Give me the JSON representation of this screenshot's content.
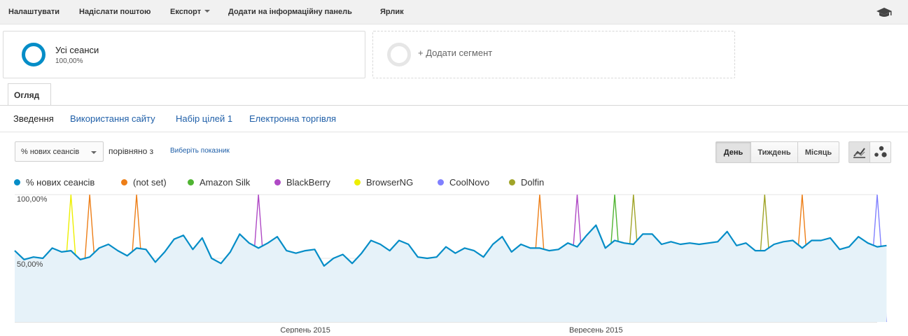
{
  "toolbar": {
    "items": [
      "Налаштувати",
      "Надіслати поштою",
      "Експорт",
      "Додати на інформаційну панель",
      "Ярлик"
    ]
  },
  "segments": {
    "all_sessions": {
      "name": "Усі сеанси",
      "percent": "100,00%"
    },
    "add_segment": "+ Додати сегмент"
  },
  "tab": {
    "label": "Огляд"
  },
  "subnav": [
    "Зведення",
    "Використання сайту",
    "Набір цілей 1",
    "Електронна торгівля"
  ],
  "controls": {
    "metric": "% нових сеансів",
    "compare": "порівняно з",
    "choose_metric": "Виберіть показник",
    "periods": [
      "День",
      "Тиждень",
      "Місяць"
    ],
    "active_period": "День"
  },
  "legend": [
    {
      "name": "% нових сеансів",
      "color": "#058dc7"
    },
    {
      "name": "(not set)",
      "color": "#ed7e17"
    },
    {
      "name": "Amazon Silk",
      "color": "#50b432"
    },
    {
      "name": "BlackBerry",
      "color": "#af49c5"
    },
    {
      "name": "BrowserNG",
      "color": "#edef00"
    },
    {
      "name": "CoolNovo",
      "color": "#8080ff"
    },
    {
      "name": "Dolfin",
      "color": "#a0a428"
    }
  ],
  "chart_data": {
    "type": "line",
    "title": "",
    "ylabel": "",
    "xlabel": "",
    "ylim": [
      0,
      100
    ],
    "y_ticks": [
      "100,00%",
      "50,00%"
    ],
    "x_tick_labels": [
      {
        "day_index": 31,
        "label": "Серпень 2015"
      },
      {
        "day_index": 62,
        "label": "Вересень 2015"
      }
    ],
    "x_days": 92,
    "grid": true,
    "series": [
      {
        "name": "% нових сеансів",
        "color": "#058dc7",
        "area": true,
        "values": [
          56,
          49,
          51,
          50,
          58,
          55,
          56,
          49,
          51,
          58,
          61,
          56,
          52,
          58,
          57,
          47,
          55,
          65,
          68,
          57,
          66,
          50,
          46,
          55,
          69,
          62,
          58,
          62,
          67,
          56,
          54,
          56,
          57,
          44,
          50,
          53,
          46,
          54,
          64,
          61,
          56,
          64,
          61,
          51,
          50,
          51,
          59,
          54,
          58,
          56,
          51,
          61,
          67,
          55,
          61,
          58,
          58,
          56,
          57,
          62,
          59,
          68,
          76,
          58,
          64,
          62,
          61,
          69,
          69,
          61,
          63,
          61,
          62,
          61,
          62,
          63,
          71,
          60,
          62,
          56,
          56,
          61,
          63,
          64,
          58,
          64,
          64,
          66,
          57,
          59,
          67,
          62,
          59,
          60
        ]
      },
      {
        "name": "(not set)",
        "color": "#ed7e17",
        "spikes": [
          8,
          13,
          56,
          84
        ]
      },
      {
        "name": "Amazon Silk",
        "color": "#50b432",
        "spikes": [
          64
        ]
      },
      {
        "name": "BlackBerry",
        "color": "#af49c5",
        "spikes": [
          26,
          60
        ]
      },
      {
        "name": "BrowserNG",
        "color": "#edef00",
        "spikes": [
          6
        ]
      },
      {
        "name": "CoolNovo",
        "color": "#8080ff",
        "spikes": [
          92
        ]
      },
      {
        "name": "Dolfin",
        "color": "#a0a428",
        "spikes": [
          66,
          80
        ]
      }
    ]
  }
}
